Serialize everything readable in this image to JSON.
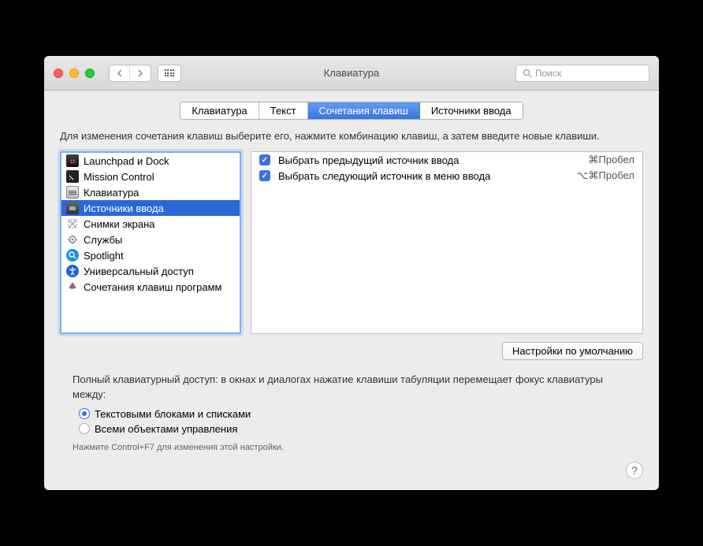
{
  "window": {
    "title": "Клавиатура",
    "search_placeholder": "Поиск"
  },
  "tabs": [
    {
      "label": "Клавиатура",
      "active": false
    },
    {
      "label": "Текст",
      "active": false
    },
    {
      "label": "Сочетания клавиш",
      "active": true
    },
    {
      "label": "Источники ввода",
      "active": false
    }
  ],
  "instruction": "Для изменения сочетания клавиш выберите его, нажмите комбинацию клавиш, а затем введите новые клавиши.",
  "categories": [
    {
      "label": "Launchpad и Dock",
      "icon": "launchpad",
      "selected": false
    },
    {
      "label": "Mission Control",
      "icon": "mission",
      "selected": false
    },
    {
      "label": "Клавиатура",
      "icon": "keyboard",
      "selected": false
    },
    {
      "label": "Источники ввода",
      "icon": "input",
      "selected": true
    },
    {
      "label": "Снимки экрана",
      "icon": "screenshot",
      "selected": false
    },
    {
      "label": "Службы",
      "icon": "services",
      "selected": false
    },
    {
      "label": "Spotlight",
      "icon": "spotlight",
      "selected": false
    },
    {
      "label": "Универсальный доступ",
      "icon": "accessibility",
      "selected": false
    },
    {
      "label": "Сочетания клавиш программ",
      "icon": "app",
      "selected": false
    }
  ],
  "shortcuts": [
    {
      "enabled": true,
      "label": "Выбрать предыдущий источник ввода",
      "keys": "⌘Пробел"
    },
    {
      "enabled": true,
      "label": "Выбрать следующий источник в меню ввода",
      "keys": "⌥⌘Пробел"
    }
  ],
  "defaults_button": "Настройки по умолчанию",
  "access": {
    "text": "Полный клавиатурный доступ: в окнах и диалогах нажатие клавиши табуляции перемещает фокус клавиатуры между:",
    "option1": "Текстовыми блоками и списками",
    "option2": "Всеми объектами управления",
    "selected": 0,
    "footnote": "Нажмите Control+F7 для изменения этой настройки."
  },
  "help_label": "?"
}
